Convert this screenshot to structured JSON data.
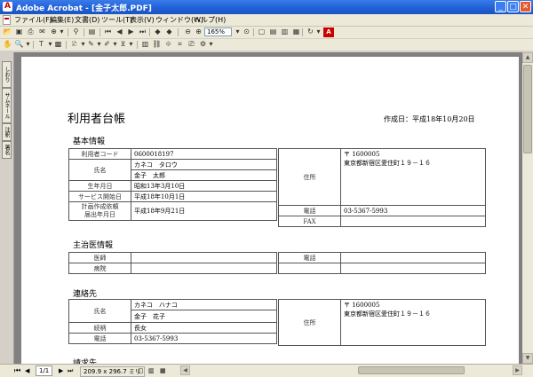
{
  "window": {
    "title": "Adobe Acrobat - [金子太郎.PDF]"
  },
  "menu": [
    "ファイル(F)",
    "編集(E)",
    "文書(D)",
    "ツール(T)",
    "表示(V)",
    "ウィンドウ(W)",
    "ヘルプ(H)"
  ],
  "toolbar": {
    "zoom": "165%",
    "text_tool": "T",
    "adobe": "A"
  },
  "nav_tabs": [
    "しおり",
    "サムネール",
    "注釈",
    "署名"
  ],
  "document": {
    "title": "利用者台帳",
    "date": "作成日：平成18年10月20日",
    "sections": {
      "basic": "基本情報",
      "doctor": "主治医情報",
      "contact": "連絡先",
      "billing": "請求先"
    },
    "basic": {
      "user_code_label": "利用者コード",
      "user_code": "0600018197",
      "name_label": "氏名",
      "name_kana": "カネコ　タロウ",
      "name": "金子　太郎",
      "birth_label": "生年月日",
      "birth": "昭和13年3月10日",
      "service_start_label": "サービス開始日",
      "service_start": "平成18年10月1日",
      "plan_label_1": "計画作成依頼",
      "plan_label_2": "届出年月日",
      "plan_date": "平成18年9月21日",
      "address_label": "住所",
      "postal": "〒 1600005",
      "address": "東京都新宿区愛住町１９－１６",
      "phone_label": "電話",
      "phone": "03-5367-5993",
      "fax_label": "FAX",
      "fax": ""
    },
    "doctor": {
      "doctor_label": "医師",
      "doctor": "",
      "hospital_label": "病院",
      "hospital": "",
      "phone_label": "電話",
      "phone": ""
    },
    "contact": {
      "name_label": "氏名",
      "name_kana": "カネコ　ハナコ",
      "name": "金子　花子",
      "relation_label": "続柄",
      "relation": "長女",
      "phone_label": "電話",
      "phone": "03-5367-5993",
      "address_label": "住所",
      "postal": "〒 1600005",
      "address": "東京都新宿区愛住町１９－１６"
    }
  },
  "status": {
    "page": "1/1",
    "size": "209.9 x 296.7 ミリ"
  }
}
